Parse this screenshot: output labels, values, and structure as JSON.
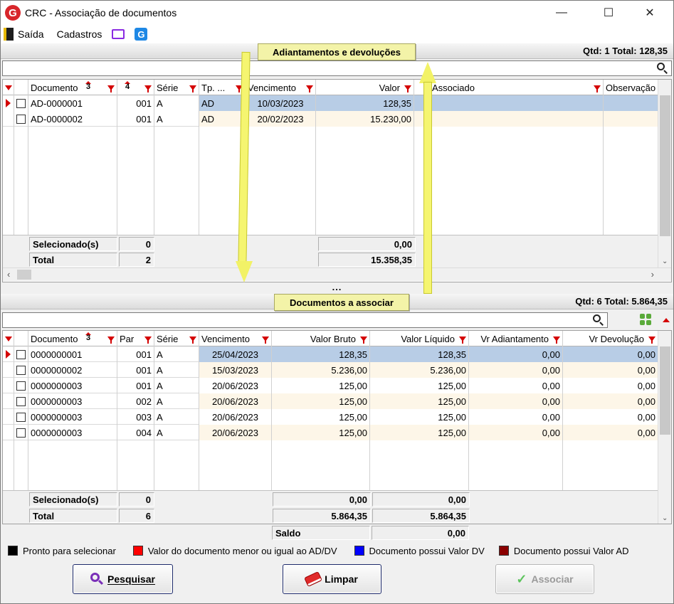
{
  "window": {
    "title": "CRC - Associação de documentos",
    "icon": "G"
  },
  "menu": {
    "exit_label": "Saída",
    "registries_label": "Cadastros"
  },
  "top": {
    "section_title": "Adiantamentos e devoluções",
    "qty_text": "Qtd: 1 Total: 128,35",
    "search_value": "",
    "columns": [
      "Documento",
      "",
      "Série",
      "Tp. ...",
      "Vencimento",
      "Valor",
      "Associado",
      "Observação"
    ],
    "sort_badges": {
      "documento": "3",
      "parcela": "4"
    },
    "rows": [
      {
        "doc": "AD-0000001",
        "par": "001",
        "serie": "A",
        "tp": "AD",
        "venc": "10/03/2023",
        "valor": "128,35",
        "assoc": "",
        "obs": ""
      },
      {
        "doc": "AD-0000002",
        "par": "001",
        "serie": "A",
        "tp": "AD",
        "venc": "20/02/2023",
        "valor": "15.230,00",
        "assoc": "",
        "obs": ""
      }
    ],
    "selected_label": "Selecionado(s)",
    "selected_count": "0",
    "selected_value": "0,00",
    "total_label": "Total",
    "total_count": "2",
    "total_value": "15.358,35"
  },
  "splitter": "...",
  "bottom": {
    "section_title": "Documentos a associar",
    "qty_text": "Qtd: 6 Total: 5.864,35",
    "search_value": "",
    "columns": [
      "Documento",
      "Par",
      "Série",
      "Vencimento",
      "Valor Bruto",
      "Valor Líquido",
      "Vr Adiantamento",
      "Vr Devolução"
    ],
    "sort_badges": {
      "documento": "3"
    },
    "rows": [
      {
        "doc": "0000000001",
        "par": "001",
        "serie": "A",
        "venc": "25/04/2023",
        "bruto": "128,35",
        "liq": "128,35",
        "adi": "0,00",
        "dev": "0,00"
      },
      {
        "doc": "0000000002",
        "par": "001",
        "serie": "A",
        "venc": "15/03/2023",
        "bruto": "5.236,00",
        "liq": "5.236,00",
        "adi": "0,00",
        "dev": "0,00"
      },
      {
        "doc": "0000000003",
        "par": "001",
        "serie": "A",
        "venc": "20/06/2023",
        "bruto": "125,00",
        "liq": "125,00",
        "adi": "0,00",
        "dev": "0,00"
      },
      {
        "doc": "0000000003",
        "par": "002",
        "serie": "A",
        "venc": "20/06/2023",
        "bruto": "125,00",
        "liq": "125,00",
        "adi": "0,00",
        "dev": "0,00"
      },
      {
        "doc": "0000000003",
        "par": "003",
        "serie": "A",
        "venc": "20/06/2023",
        "bruto": "125,00",
        "liq": "125,00",
        "adi": "0,00",
        "dev": "0,00"
      },
      {
        "doc": "0000000003",
        "par": "004",
        "serie": "A",
        "venc": "20/06/2023",
        "bruto": "125,00",
        "liq": "125,00",
        "adi": "0,00",
        "dev": "0,00"
      }
    ],
    "selected_label": "Selecionado(s)",
    "selected_count": "0",
    "selected_bruto": "0,00",
    "selected_liq": "0,00",
    "total_label": "Total",
    "total_count": "6",
    "total_bruto": "5.864,35",
    "total_liq": "5.864,35",
    "saldo_label": "Saldo",
    "saldo_value": "0,00"
  },
  "legend": [
    {
      "color": "#000000",
      "label": "Pronto para selecionar"
    },
    {
      "color": "#ff0000",
      "label": "Valor do documento menor ou igual ao AD/DV"
    },
    {
      "color": "#0000ff",
      "label": "Documento possui Valor DV"
    },
    {
      "color": "#8b0000",
      "label": "Documento possui Valor AD"
    }
  ],
  "buttons": {
    "search": "Pesquisar",
    "clear": "Limpar",
    "associate": "Associar"
  },
  "colors": {
    "selected_row": "#b8cde6",
    "alt_row": "#fdf6e8",
    "section_label_bg": "#f3f3a8",
    "filter": "#d40000"
  }
}
